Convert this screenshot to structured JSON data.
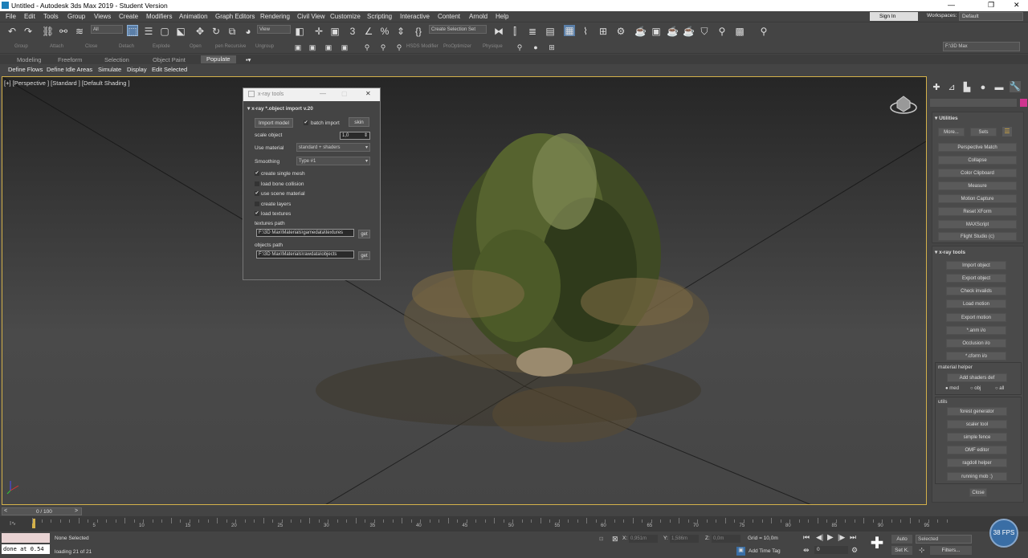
{
  "window": {
    "title": "Untitled - Autodesk 3ds Max 2019 - Student Version"
  },
  "menu": [
    "File",
    "Edit",
    "Tools",
    "Group",
    "Views",
    "Create",
    "Modifiers",
    "Animation",
    "Graph Editors",
    "Rendering",
    "Civil View",
    "Customize",
    "Scripting",
    "Interactive",
    "Content",
    "Arnold",
    "Help"
  ],
  "signin": "Sign In",
  "workspaces_label": "Workspaces:",
  "workspaces_value": "Default",
  "toolbar": {
    "filter": "All",
    "view": "View",
    "selection_set": "Create Selection Set",
    "path": "F:\\3D Max"
  },
  "toolbar2_labels": [
    "Group",
    "Attach",
    "Close",
    "Detach",
    "Explode",
    "Open",
    "pen Recursive",
    "Ungroup",
    "HSDS Modifier",
    "ProOptimizer",
    "Physique"
  ],
  "ribbon": {
    "tabs": [
      "Modeling",
      "Freeform",
      "Selection",
      "Object Paint",
      "Populate"
    ],
    "active_tab": "Populate",
    "sub": [
      "Define Flows",
      "Define Idle Areas",
      "Simulate",
      "Display",
      "Edit Selected"
    ]
  },
  "viewport": {
    "label": "[+] [Perspective ] [Standard ] [Default Shading ]"
  },
  "dialog": {
    "title": "x-ray tools",
    "rollout": "x-ray *.object import v.20",
    "import_btn": "Import model",
    "batch_import": "batch import",
    "skin_btn": "skin",
    "scale_label": "scale object",
    "scale_value": "1,0",
    "material_label": "Use material",
    "material_value": "standard + shaders",
    "smoothing_label": "Smoothing",
    "smoothing_value": "Type #1",
    "checks": [
      {
        "label": "create single mesh",
        "checked": true
      },
      {
        "label": "load bone collision",
        "checked": false
      },
      {
        "label": "use scene material",
        "checked": true
      },
      {
        "label": "create layers",
        "checked": false
      },
      {
        "label": "load textures",
        "checked": true
      }
    ],
    "textures_label": "textures path",
    "textures_value": "F:\\3D Max\\Materials\\gamedata\\textures",
    "objects_label": "objects path",
    "objects_value": "F:\\3D Max\\Materials\\rawdata\\objects",
    "get": "get"
  },
  "cmdpanel": {
    "utilities_head": "Utilities",
    "more": "More...",
    "sets": "Sets",
    "utilities": [
      "Perspective Match",
      "Collapse",
      "Color Clipboard",
      "Measure",
      "Motion Capture",
      "Reset XForm",
      "MAXScript",
      "Flight Studio (c)"
    ],
    "xray_head": "x-ray tools",
    "xray": [
      "Import object",
      "Export object",
      "Check invalids",
      "Load motion",
      "Export motion",
      "*.anm i/o",
      "Occlusion i/o",
      "*.cform i/o"
    ],
    "material_helper": "material helper",
    "add_shaders": "Add shaders def",
    "radios": [
      "med",
      "obj",
      "all"
    ],
    "utils_head": "utils",
    "utils": [
      "forest generator",
      "scaler tool",
      "simple fence",
      "OMF editor",
      "ragdoll helper",
      "running mob :)"
    ],
    "close": "Close"
  },
  "timeline": {
    "frame": "0 / 100",
    "ticks": [
      "0",
      "5",
      "10",
      "15",
      "20",
      "25",
      "30",
      "35",
      "40",
      "45",
      "50",
      "55",
      "60",
      "65",
      "70",
      "75",
      "80",
      "85",
      "90",
      "95",
      "100"
    ]
  },
  "status": {
    "script": "done at 0.54",
    "selected": "None Selected",
    "loading": "loading 21 of 21",
    "x_label": "X:",
    "x_value": "0,951m",
    "y_label": "Y:",
    "y_value": "1,586m",
    "z_label": "Z:",
    "z_value": "0,0m",
    "grid": "Grid = 10,0m",
    "add_time_tag": "Add Time Tag",
    "auto": "Auto",
    "selected_mode": "Selected",
    "set_k": "Set K.",
    "filters": "Filters...",
    "frame_value": "0",
    "fps": "38 FPS"
  },
  "colors": {
    "accent": "#d4b14a",
    "panel": "#444444",
    "dialog_title": "#f0f0f0"
  }
}
